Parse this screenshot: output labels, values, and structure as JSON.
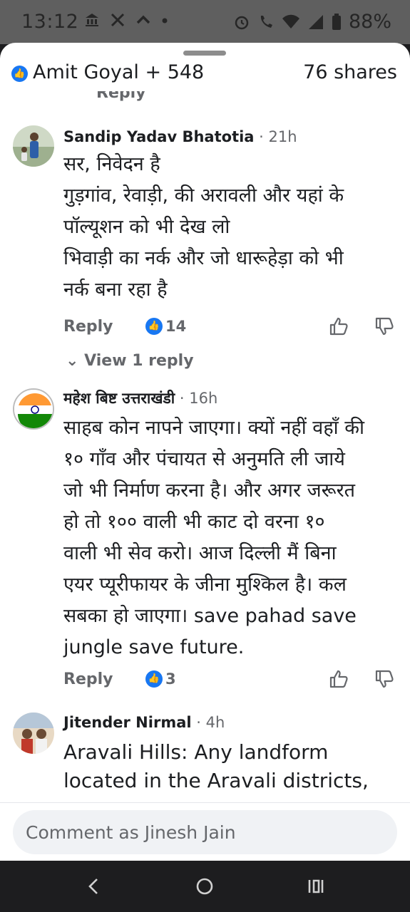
{
  "status_bar": {
    "time": "13:12",
    "left_icons": [
      "bank-icon",
      "x-icon",
      "chevron-up-icon",
      "dot-icon"
    ],
    "right_icons": [
      "alarm-icon",
      "wifi-call-icon",
      "wifi-icon",
      "signal-icon",
      "battery-icon"
    ],
    "battery": "88%"
  },
  "header": {
    "reactions": "Amit Goyal + 548",
    "shares": "76 shares"
  },
  "partial_prev": {
    "reply_label": "Reply"
  },
  "comments": [
    {
      "author": "Sandip Yadav Bhatotia",
      "time": "· 21h",
      "lines": [
        "सर, निवेदन है",
        "गुड़गांव, रेवाड़ी, की अरावली और यहां के",
        "पॉल्यूशन को भी देख लो",
        "भिवाड़ी का नर्क और जो धारूहेड़ा को भी",
        "नर्क बना रहा है"
      ],
      "reply_label": "Reply",
      "reaction_count": "14",
      "view_replies": "View 1 reply"
    },
    {
      "author": "महेश बिष्ट उत्तराखंडी",
      "time": "· 16h",
      "lines": [
        "साहब कोन नापने जाएगा। क्यों नहीं वहाँ की",
        "१० गाँव और पंचायत से अनुमति ली जाये",
        "जो भी निर्माण करना है। और अगर जरूरत",
        "हो तो १०० वाली भी काट दो वरना १०",
        "वाली भी सेव करो। आज दिल्ली मैं बिना",
        "एयर प्यूरीफायर के जीना मुश्किल है। कल",
        "सबका हो जाएगा। save pahad save",
        "jungle save future."
      ],
      "reply_label": "Reply",
      "reaction_count": "3"
    },
    {
      "author": "Jitender Nirmal",
      "time": "· 4h",
      "lines": [
        "Aravali Hills: Any landform",
        "located in the Aravali districts,"
      ]
    }
  ],
  "composer": {
    "placeholder": "Comment as Jinesh Jain"
  },
  "navbar": {
    "buttons": [
      "back-icon",
      "home-icon",
      "recents-icon"
    ]
  },
  "colors": {
    "facebook_blue": "#1877f2",
    "secondary_text": "#65676b",
    "status_bar_bg": "#5f5f5f",
    "nav_bg": "#1d1d1f"
  }
}
